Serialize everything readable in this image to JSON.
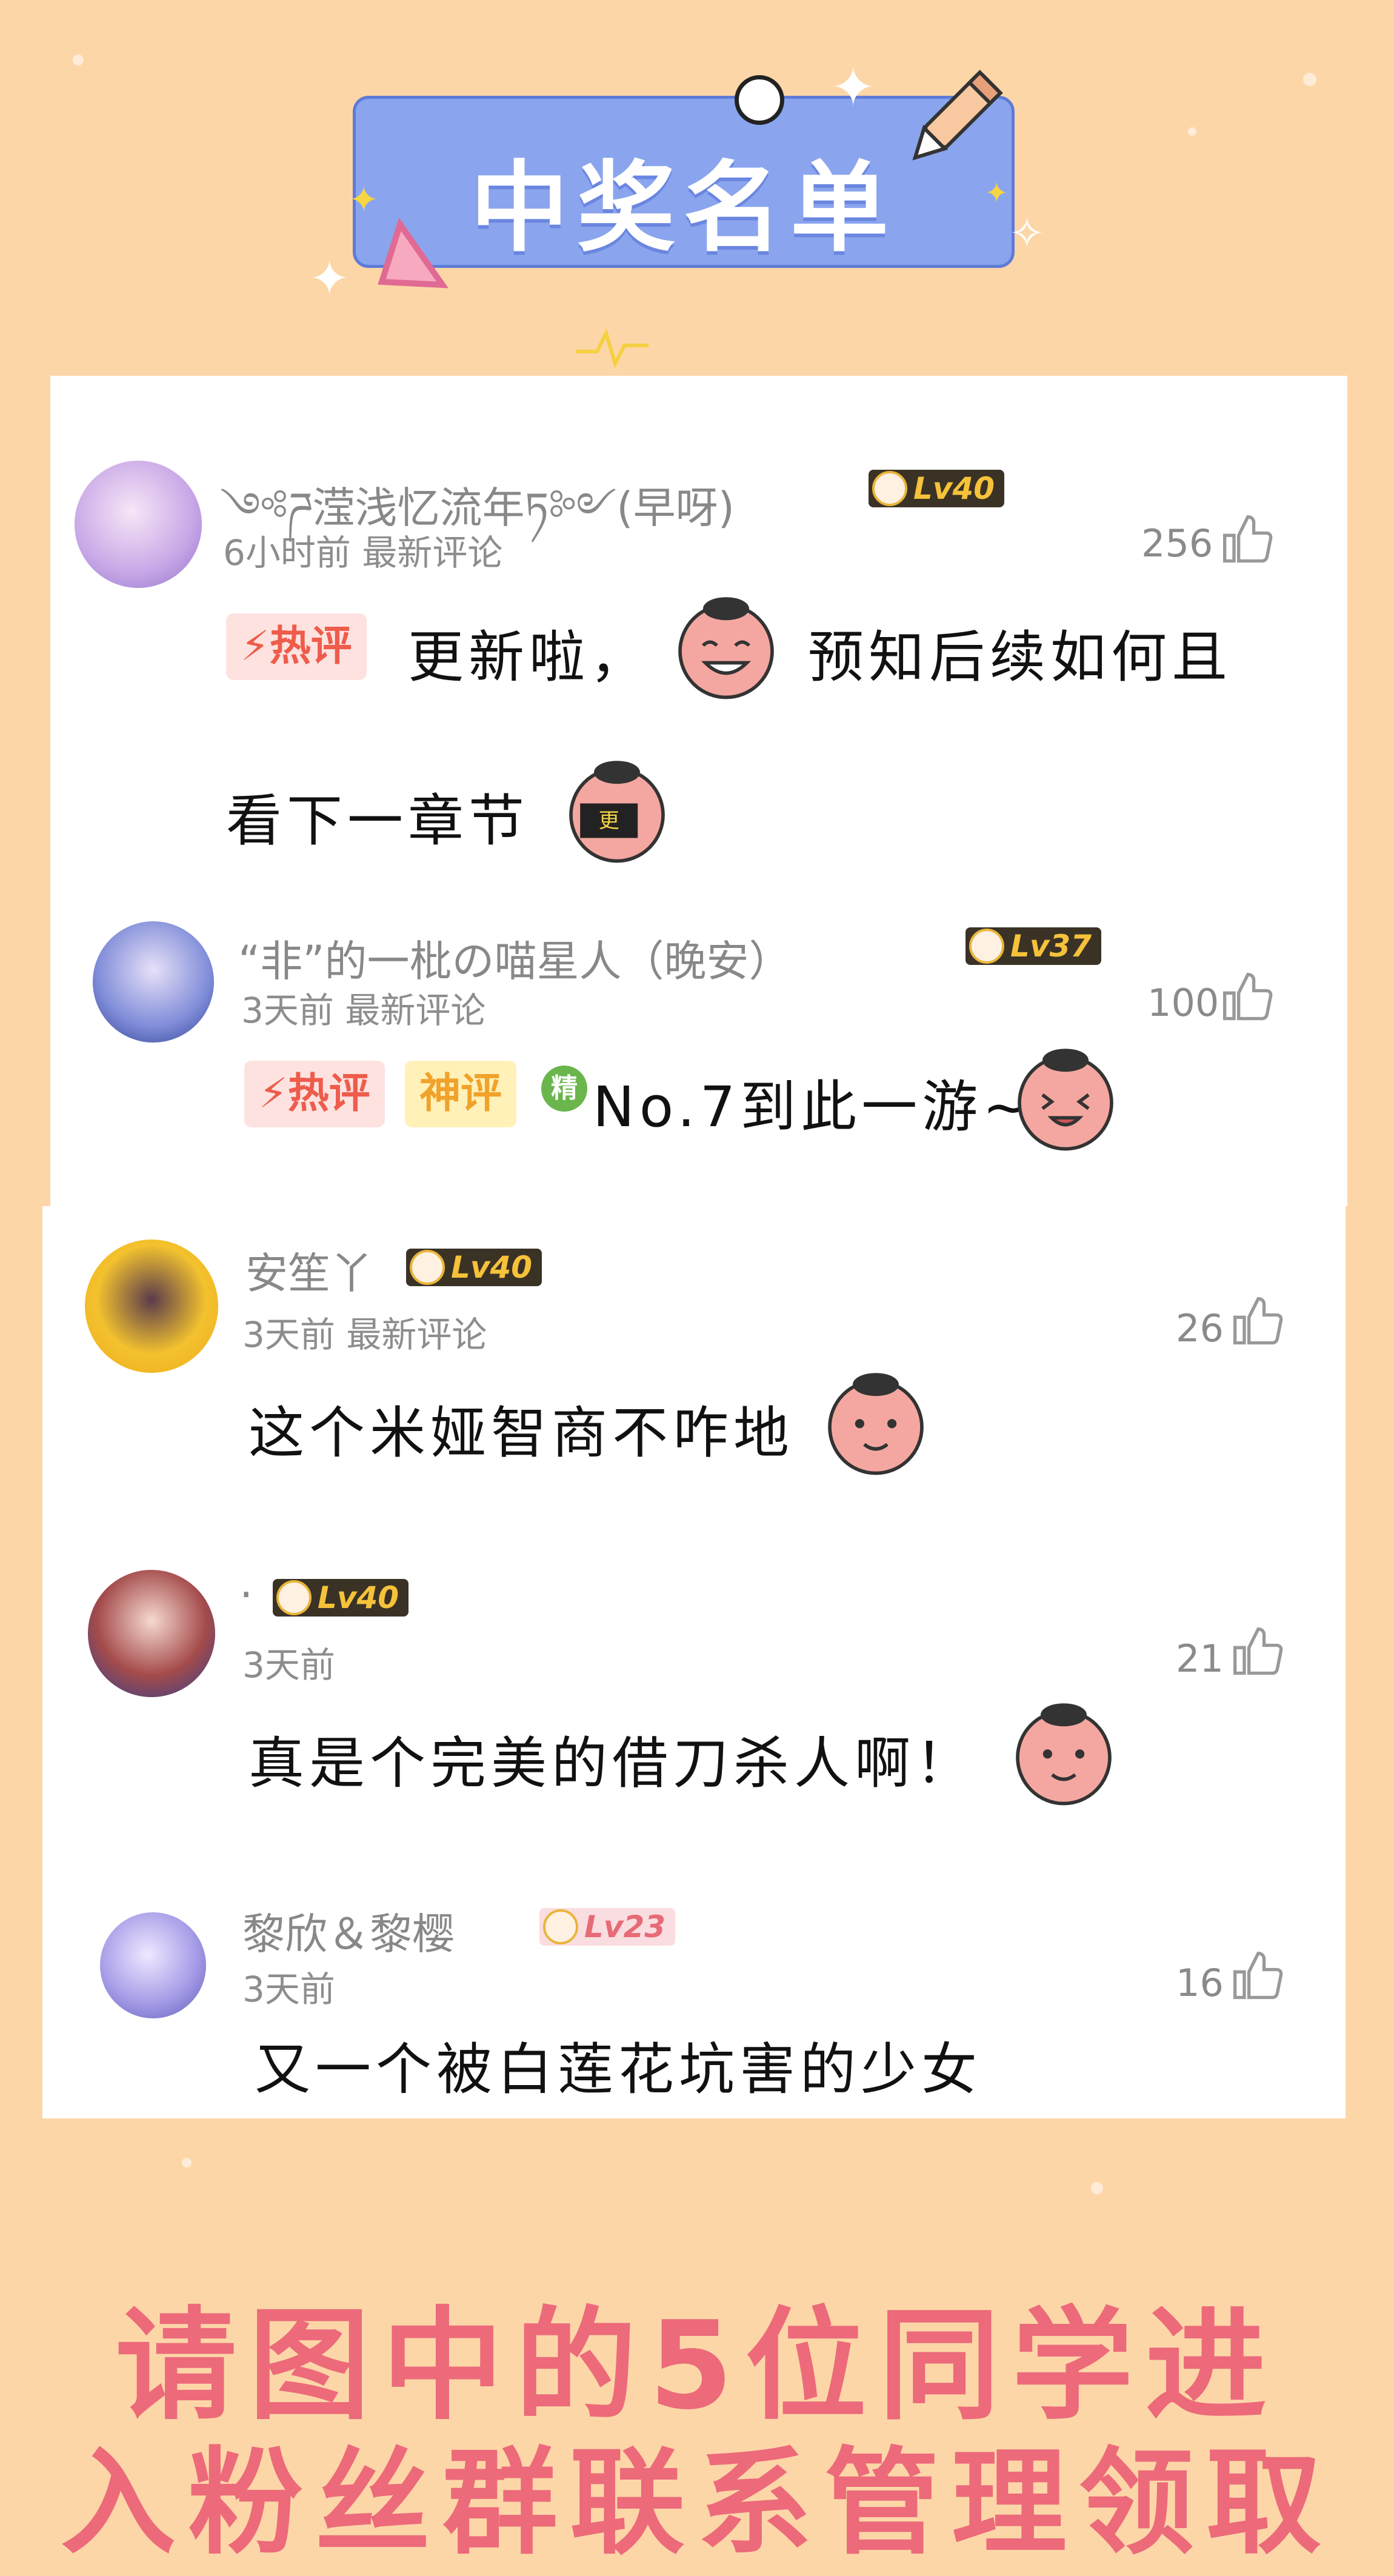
{
  "banner": {
    "title": "中奖名单"
  },
  "colors": {
    "background": "#fdd6a8",
    "banner": "#8aa5ee",
    "footer_text": "#ec6a7a",
    "level_badge": "#3b3226"
  },
  "comments": [
    {
      "username": "༺ཌ滢浅忆流年ཏ༻(早呀)",
      "level": "Lv40",
      "time": "6小时前",
      "section": "最新评论",
      "likes": "256",
      "tags": [
        "热评"
      ],
      "text_line1": "更新啦，",
      "text_line1b": "预知后续如何且",
      "text_line2": "看下一章节"
    },
    {
      "username": "“非”的一枇の喵星人（晚安）",
      "level": "Lv37",
      "time": "3天前",
      "section": "最新评论",
      "likes": "100",
      "tags": [
        "热评",
        "神评"
      ],
      "featured_badge": "精",
      "text": "No.7到此一游~"
    },
    {
      "username": "安笙丫",
      "level": "Lv40",
      "time": "3天前",
      "section": "最新评论",
      "likes": "26",
      "text": "这个米娅智商不咋地"
    },
    {
      "username": ".",
      "level": "Lv40",
      "time": "3天前",
      "likes": "21",
      "text": "真是个完美的借刀杀人啊！"
    },
    {
      "username": "黎欣＆黎樱",
      "level": "Lv23",
      "time": "3天前",
      "likes": "16",
      "text": "又一个被白莲花坑害的少女"
    }
  ],
  "footer": {
    "line1": "请图中的5位同学进",
    "line2": "入粉丝群联系管理领取"
  },
  "icons": [
    "thumbs-up-icon",
    "lightning-icon",
    "crown-icon",
    "pencil-icon",
    "sparkle-icon"
  ]
}
